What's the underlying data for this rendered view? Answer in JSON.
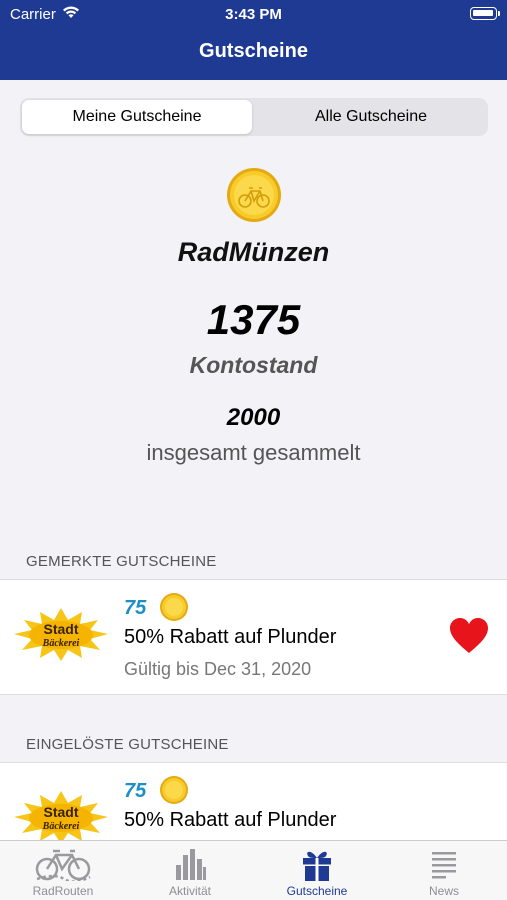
{
  "status_bar": {
    "carrier": "Carrier",
    "time": "3:43 PM"
  },
  "nav": {
    "title": "Gutscheine"
  },
  "segments": {
    "mine": "Meine Gutscheine",
    "all": "Alle Gutscheine",
    "selected": "mine"
  },
  "summary": {
    "currency_name": "RadMünzen",
    "balance": "1375",
    "balance_label": "Kontostand",
    "total_collected": "2000",
    "total_label": "insgesamt gesammelt"
  },
  "saved_section": {
    "header": "GEMERKTE GUTSCHEINE",
    "items": [
      {
        "price": "75",
        "title": "50% Rabatt auf Plunder",
        "valid": "Gültig bis Dec 31, 2020",
        "logo_text_1": "Stadt",
        "logo_text_2": "Bäckerei",
        "favorited": true
      }
    ]
  },
  "redeemed_section": {
    "header": "EINGELÖSTE GUTSCHEINE",
    "items": [
      {
        "price": "75",
        "title": "50% Rabatt auf Plunder",
        "logo_text_1": "Stadt",
        "logo_text_2": "Bäckerei"
      }
    ]
  },
  "tabs": [
    {
      "label": "RadRouten",
      "icon": "bike-route-icon"
    },
    {
      "label": "Aktivität",
      "icon": "bar-chart-icon"
    },
    {
      "label": "Gutscheine",
      "icon": "gift-icon",
      "active": true
    },
    {
      "label": "News",
      "icon": "news-lines-icon"
    }
  ],
  "colors": {
    "nav_bar": "#1f3a93",
    "price": "#1d8fc7",
    "heart": "#e8141c",
    "coin": "#f5c518"
  }
}
